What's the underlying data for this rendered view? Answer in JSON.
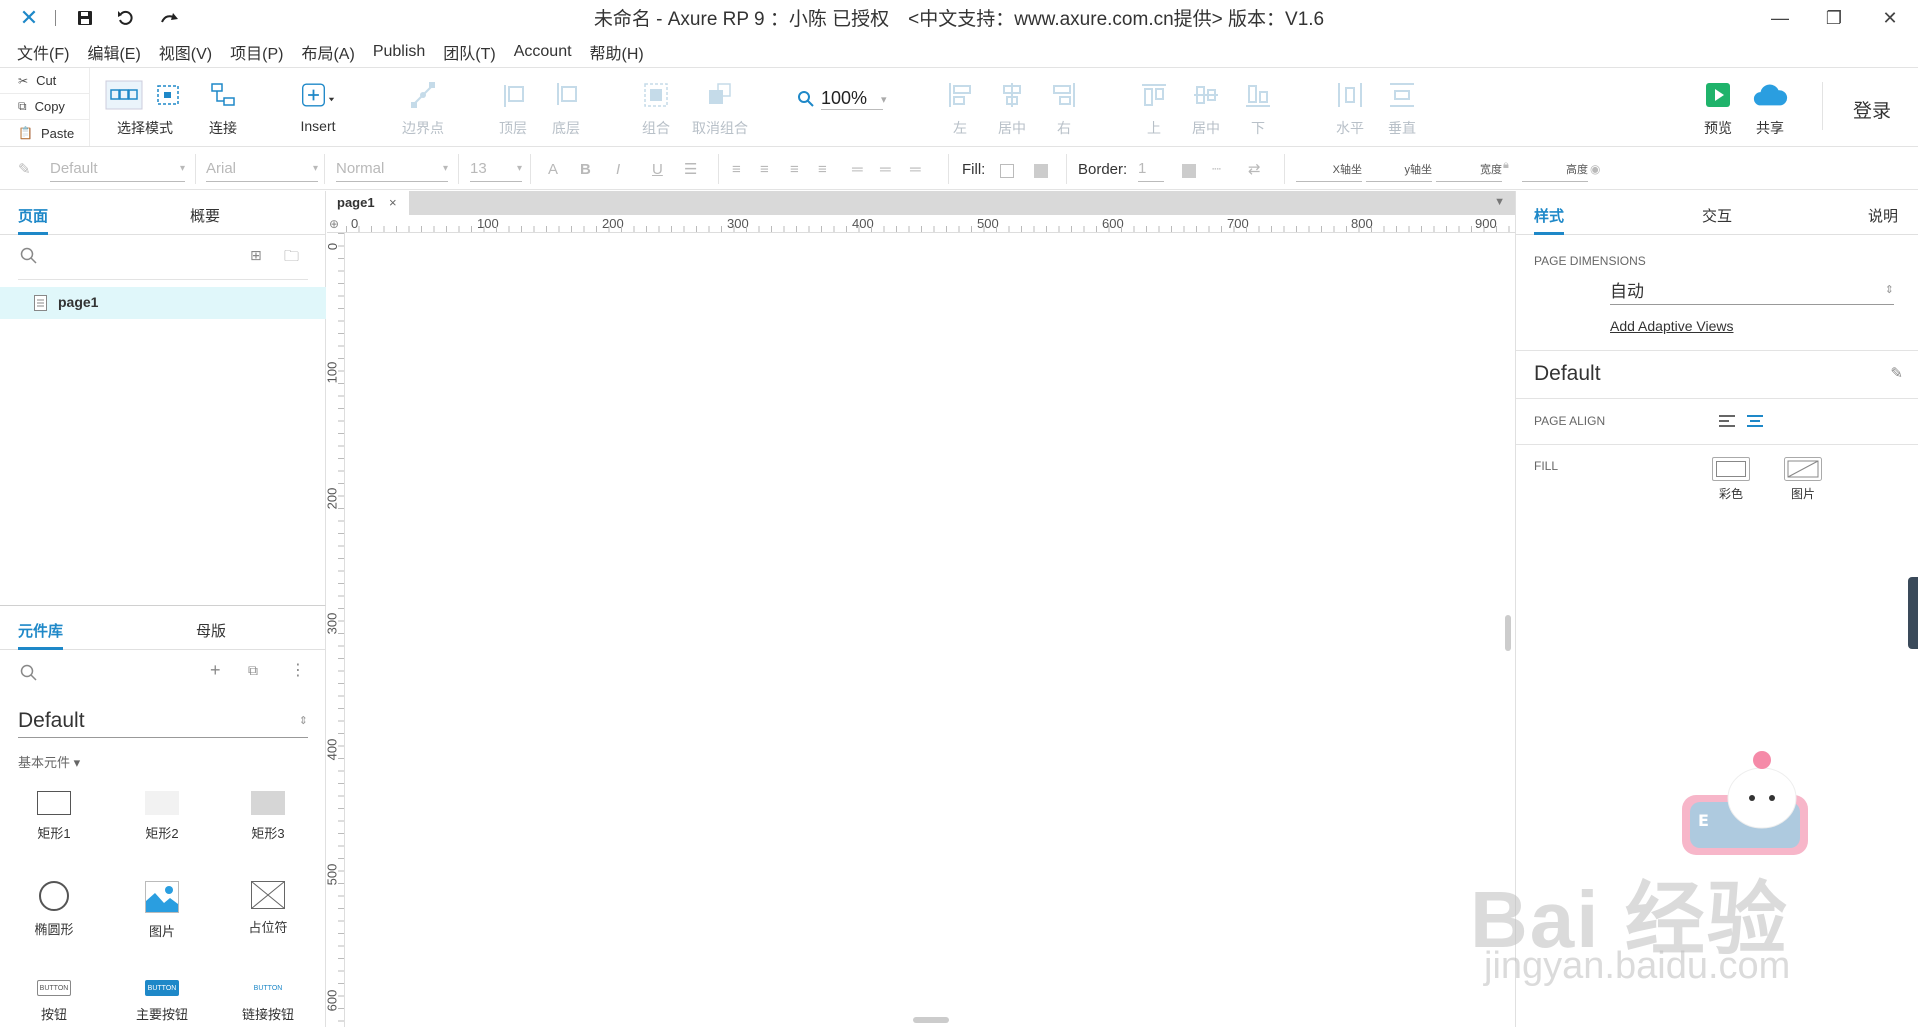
{
  "titlebar": {
    "title": "未命名 - Axure RP 9 ：小陈 已授权　<中文支持：www.axure.com.cn提供> 版本：V1.6"
  },
  "menu": [
    "文件(F)",
    "编辑(E)",
    "视图(V)",
    "项目(P)",
    "布局(A)",
    "Publish",
    "团队(T)",
    "Account",
    "帮助(H)"
  ],
  "clipboard": {
    "cut": "Cut",
    "copy": "Copy",
    "paste": "Paste"
  },
  "toolbar": {
    "select_mode": "选择模式",
    "connect": "连接",
    "insert": "Insert",
    "border_point": "边界点",
    "zoom": "100%",
    "top_layer": "顶层",
    "bottom_layer": "底层",
    "group": "组合",
    "ungroup": "取消组合",
    "left": "左",
    "center": "居中",
    "right": "右",
    "top": "上",
    "middle": "居中",
    "bottom": "下",
    "horizontal": "水平",
    "vertical": "垂直",
    "preview": "预览",
    "share": "共享",
    "login": "登录"
  },
  "format": {
    "style": "Default",
    "font": "Arial",
    "weight": "Normal",
    "size": "13",
    "fill_label": "Fill:",
    "border_label": "Border:",
    "border_value": "1",
    "x_label": "X轴坐",
    "y_label": "y轴坐",
    "w_label": "宽度",
    "h_label": "高度"
  },
  "pages": {
    "tab_pages": "页面",
    "tab_outline": "概要",
    "items": [
      "page1"
    ]
  },
  "library": {
    "tab_libraries": "元件库",
    "tab_masters": "母版",
    "selected": "Default",
    "category": "基本元件 ▾",
    "widgets": [
      "矩形1",
      "矩形2",
      "矩形3",
      "椭圆形",
      "图片",
      "占位符",
      "按钮",
      "主要按钮",
      "链接按钮"
    ],
    "button_text": "BUTTON"
  },
  "canvas": {
    "tab": "page1",
    "ruler_h": [
      "0",
      "100",
      "200",
      "300",
      "400",
      "500",
      "600",
      "700",
      "800",
      "900"
    ],
    "ruler_v": [
      "0",
      "100",
      "200",
      "300",
      "400",
      "500",
      "600"
    ]
  },
  "inspector": {
    "tab_style": "样式",
    "tab_interactions": "交互",
    "tab_notes": "说明",
    "page_dimensions_label": "PAGE DIMENSIONS",
    "page_dimensions_value": "自动",
    "adaptive_link": "Add Adaptive Views",
    "style_name": "Default",
    "page_align_label": "PAGE ALIGN",
    "fill_label": "FILL",
    "fill_color": "彩色",
    "fill_image": "图片"
  },
  "watermark": {
    "brand": "Bai 经验",
    "url": "jingyan.baidu.com"
  },
  "colors": {
    "accent": "#1e88c8",
    "preview_green": "#1fb36b",
    "share_blue": "#2a9ee0",
    "selection": "#e0f7fa"
  }
}
